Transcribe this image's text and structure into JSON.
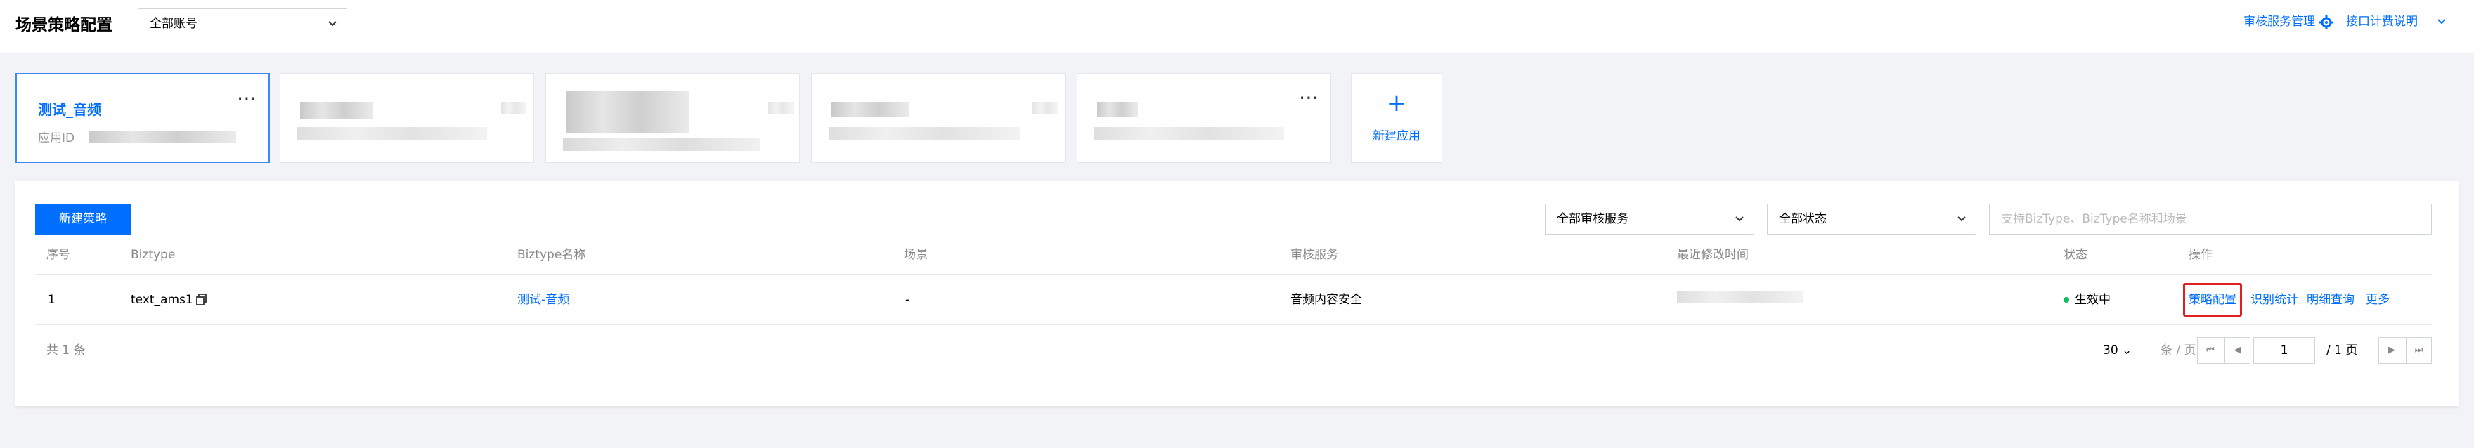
{
  "header": {
    "title": "场景策略配置",
    "account_select": "全部账号",
    "links": [
      {
        "label": "审核服务管理"
      },
      {
        "label": "接口计费说明"
      }
    ]
  },
  "apps": [
    {
      "name": "测试_音频",
      "id_label": "应用ID",
      "active": true
    },
    {
      "name": "",
      "id_label": "",
      "active": false
    },
    {
      "name": "",
      "id_label": "",
      "active": false
    },
    {
      "name": "",
      "id_label": "",
      "active": false
    },
    {
      "name": "",
      "id_label": "",
      "active": false
    }
  ],
  "add_app": {
    "label": "新建应用"
  },
  "toolbar": {
    "new_policy": "新建策略",
    "service_filter": "全部审核服务",
    "status_filter": "全部状态",
    "search_placeholder": "支持BizType、BizType名称和场景"
  },
  "table": {
    "headers": [
      "序号",
      "Biztype",
      "Biztype名称",
      "场景",
      "审核服务",
      "最近修改时间",
      "状态",
      "操作"
    ],
    "rows": [
      {
        "index": "1",
        "biztype": "text_ams1",
        "biztype_name": "测试-音频",
        "scene": "-",
        "service": "音频内容安全",
        "modified": "",
        "status": "生效中",
        "actions": [
          "策略配置",
          "识别统计",
          "明细查询",
          "更多"
        ]
      }
    ]
  },
  "footer": {
    "total": "共 1 条",
    "page_size": "30",
    "page_size_unit": "条 / 页",
    "page_current": "1",
    "page_total": "/ 1 页"
  },
  "colors": {
    "primary": "#006eff",
    "status_active": "#0abf5b",
    "highlight": "#e02020"
  }
}
